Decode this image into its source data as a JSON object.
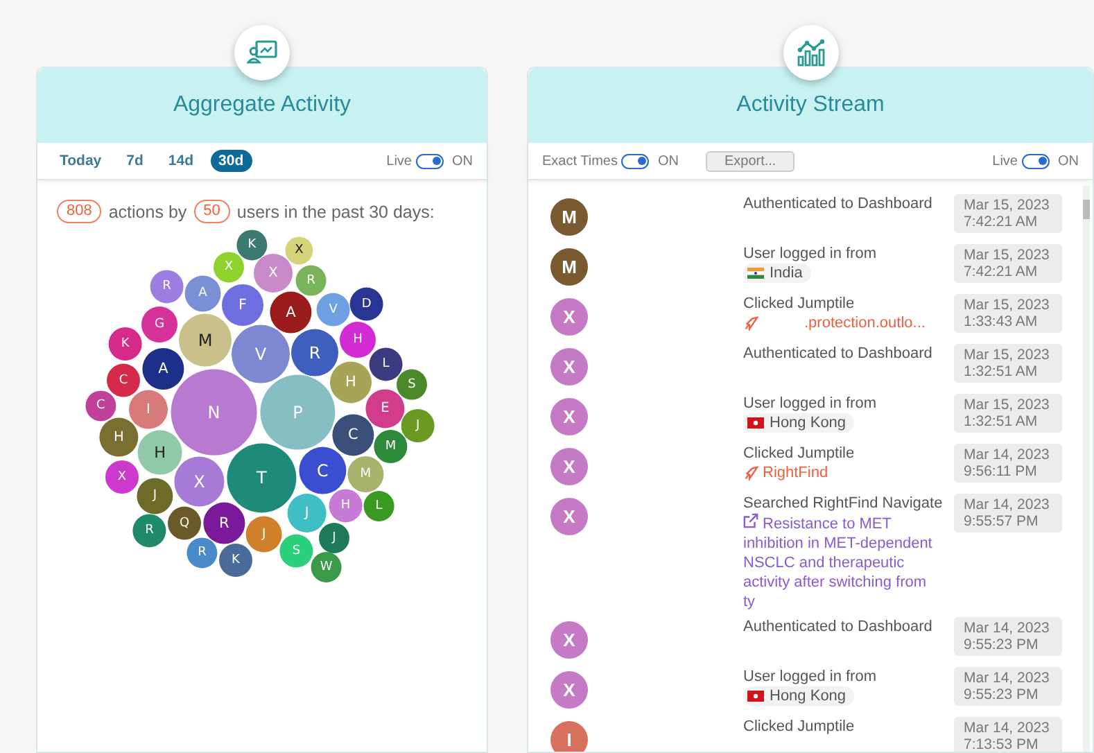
{
  "aggregate": {
    "title": "Aggregate Activity",
    "ranges": [
      {
        "label": "Today",
        "selected": false
      },
      {
        "label": "7d",
        "selected": false
      },
      {
        "label": "14d",
        "selected": false
      },
      {
        "label": "30d",
        "selected": true
      }
    ],
    "live": {
      "label": "Live",
      "on": true,
      "state": "ON"
    },
    "summary": {
      "actions": "808",
      "actions_text": "actions by",
      "users": "50",
      "users_text": "users in the past 30 days:"
    },
    "bubbles": [
      {
        "letter": "K",
        "color": "#3d7a6e"
      },
      {
        "letter": "X",
        "color": "#d4d37a"
      },
      {
        "letter": "R",
        "color": "#9b7ee0"
      },
      {
        "letter": "X",
        "color": "#8fd22e"
      },
      {
        "letter": "X",
        "color": "#c98ac9"
      },
      {
        "letter": "R",
        "color": "#79b35a"
      },
      {
        "letter": "A",
        "color": "#7b8fd6"
      },
      {
        "letter": "F",
        "color": "#6f6ee0"
      },
      {
        "letter": "A",
        "color": "#9b1c1c"
      },
      {
        "letter": "V",
        "color": "#6fa0e3"
      },
      {
        "letter": "D",
        "color": "#283593"
      },
      {
        "letter": "K",
        "color": "#d62b8a"
      },
      {
        "letter": "G",
        "color": "#d6339a"
      },
      {
        "letter": "M",
        "color": "#c9c08a"
      },
      {
        "letter": "H",
        "color": "#d42ad4"
      },
      {
        "letter": "A",
        "color": "#1e2f8a"
      },
      {
        "letter": "V",
        "color": "#7d88d0"
      },
      {
        "letter": "R",
        "color": "#3f5fbf"
      },
      {
        "letter": "L",
        "color": "#3e3a80"
      },
      {
        "letter": "C",
        "color": "#d62a4a"
      },
      {
        "letter": "H",
        "color": "#a8a455"
      },
      {
        "letter": "S",
        "color": "#4a8a2a"
      },
      {
        "letter": "C",
        "color": "#c0409a"
      },
      {
        "letter": "I",
        "color": "#d97a7a"
      },
      {
        "letter": "N",
        "color": "#b77ad0"
      },
      {
        "letter": "P",
        "color": "#85bfc4"
      },
      {
        "letter": "E",
        "color": "#d23c8c"
      },
      {
        "letter": "J",
        "color": "#6a9a22"
      },
      {
        "letter": "H",
        "color": "#7a6e30"
      },
      {
        "letter": "H",
        "color": "#8fc9a8"
      },
      {
        "letter": "C",
        "color": "#3a4f7a"
      },
      {
        "letter": "M",
        "color": "#2d8a3a"
      },
      {
        "letter": "X",
        "color": "#cc3acc"
      },
      {
        "letter": "X",
        "color": "#a67ad6"
      },
      {
        "letter": "T",
        "color": "#1e8a7a"
      },
      {
        "letter": "C",
        "color": "#3a4fd0"
      },
      {
        "letter": "M",
        "color": "#a9b26a"
      },
      {
        "letter": "J",
        "color": "#6e6a2a"
      },
      {
        "letter": "J",
        "color": "#3fbfc4"
      },
      {
        "letter": "H",
        "color": "#c77ad6"
      },
      {
        "letter": "L",
        "color": "#3a9a22"
      },
      {
        "letter": "R",
        "color": "#1e8a6a"
      },
      {
        "letter": "Q",
        "color": "#6a5a2a"
      },
      {
        "letter": "R",
        "color": "#7a1a9a"
      },
      {
        "letter": "J",
        "color": "#d0802a"
      },
      {
        "letter": "J",
        "color": "#1e7a5a"
      },
      {
        "letter": "R",
        "color": "#4a8acb"
      },
      {
        "letter": "K",
        "color": "#4a6a9a"
      },
      {
        "letter": "S",
        "color": "#2ad07a"
      },
      {
        "letter": "W",
        "color": "#3a9a4a"
      }
    ]
  },
  "stream": {
    "title": "Activity Stream",
    "exact_times": {
      "label": "Exact Times",
      "on": true,
      "state": "ON"
    },
    "export": "Export...",
    "live": {
      "label": "Live",
      "on": true,
      "state": "ON"
    },
    "events": [
      {
        "kind": "plain",
        "avatar": "M",
        "color": "#7a5a30",
        "text": "Authenticated to Dashboard",
        "date": "Mar 15, 2023",
        "time": "7:42:21 AM"
      },
      {
        "kind": "location",
        "avatar": "M",
        "color": "#7a5a30",
        "text": "User logged in from",
        "flag": {
          "kind": "in"
        },
        "place": "India",
        "date": "Mar 15, 2023",
        "time": "7:42:21 AM"
      },
      {
        "kind": "jumptile",
        "avatar": "X",
        "color": "#c47ac4",
        "text": "Clicked Jumptile",
        "link": ".protection.outlo...",
        "redacted": true,
        "date": "Mar 15, 2023",
        "time": "1:33:43 AM"
      },
      {
        "kind": "plain",
        "avatar": "X",
        "color": "#c47ac4",
        "text": "Authenticated to Dashboard",
        "date": "Mar 15, 2023",
        "time": "1:32:51 AM"
      },
      {
        "kind": "location",
        "avatar": "X",
        "color": "#c47ac4",
        "text": "User logged in from",
        "flag": {
          "kind": "hk"
        },
        "place": "Hong Kong",
        "date": "Mar 15, 2023",
        "time": "1:32:51 AM"
      },
      {
        "kind": "jumptile",
        "avatar": "X",
        "color": "#c47ac4",
        "text": "Clicked Jumptile",
        "link": "RightFind",
        "date": "Mar 14, 2023",
        "time": "9:56:11 PM"
      },
      {
        "kind": "search",
        "avatar": "X",
        "color": "#c47ac4",
        "text": "Searched RightFind Navigate",
        "link": "Resistance to MET inhibition in MET-dependent NSCLC and therapeutic activity after switching from ty",
        "date": "Mar 14, 2023",
        "time": "9:55:57 PM"
      },
      {
        "kind": "plain",
        "avatar": "X",
        "color": "#c47ac4",
        "text": "Authenticated to Dashboard",
        "date": "Mar 14, 2023",
        "time": "9:55:23 PM"
      },
      {
        "kind": "location",
        "avatar": "X",
        "color": "#c47ac4",
        "text": "User logged in from",
        "flag": {
          "kind": "hk"
        },
        "place": "Hong Kong",
        "date": "Mar 14, 2023",
        "time": "9:55:23 PM"
      },
      {
        "kind": "plain",
        "avatar": "I",
        "color": "#d87060",
        "text": "Clicked Jumptile",
        "date": "Mar 14, 2023",
        "time": "7:13:53 PM"
      }
    ]
  }
}
